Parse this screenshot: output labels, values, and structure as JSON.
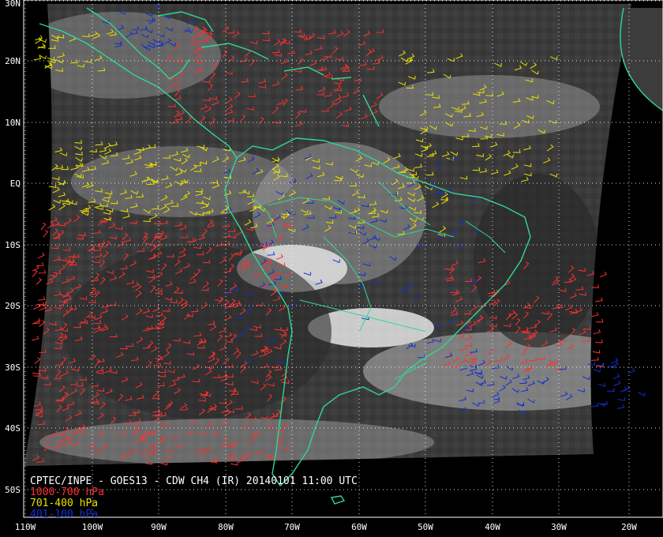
{
  "map": {
    "satellite_source": "CPTEC/INPE - GOES13 - CDW CH4 (IR) 20140101 11:00 UTC",
    "lat_labels": [
      "30N",
      "20N",
      "10N",
      "EQ",
      "10S",
      "20S",
      "30S",
      "40S",
      "50S"
    ],
    "lon_labels": [
      "110W",
      "100W",
      "90W",
      "80W",
      "70W",
      "60W",
      "50W",
      "40W",
      "30W",
      "20W"
    ],
    "legend": [
      {
        "label": "1000-700 hPa",
        "color": "#ff3030"
      },
      {
        "label": "701-400 hPa",
        "color": "#e8e000"
      },
      {
        "label": "401-100 hPa",
        "color": "#1030d0"
      }
    ],
    "coastline_color": "#30d890",
    "grid": "dotted-white",
    "background_color": "#000000",
    "imagery": "grayscale-infrared"
  }
}
